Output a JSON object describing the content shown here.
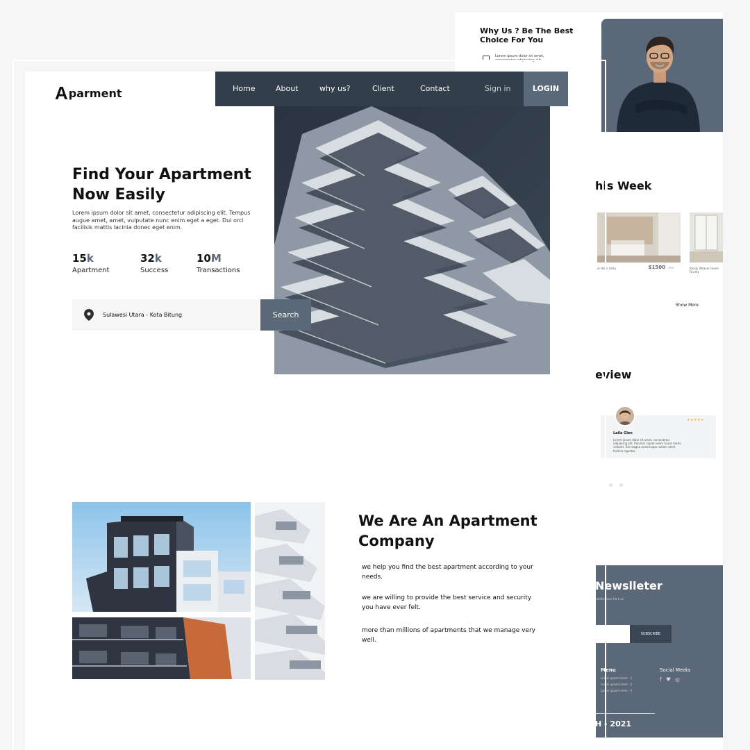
{
  "back_page": {
    "why_us": {
      "title": "Why Us ? Be The Best Choice For You",
      "item_text": "Lorem ipsum dolor sit amet, consectetur adipiscing elit."
    },
    "this_week": {
      "title": "his Week",
      "cards": [
        {
          "caption": "el Hotel Unity",
          "price": "$1500",
          "per": "/mo"
        },
        {
          "caption": "Ready Weaver Home Facility",
          "price": "",
          "per": ""
        }
      ],
      "show_more": "Show More"
    },
    "review": {
      "title": "eview",
      "name": "Laila Glen",
      "text": "Lorem ipsum dolor sit amet, consectetur adipiscing elit. Pulvinar sapien enim turpis morbi sodales. Est magna scelerisque nullam amet facilisis egestas.",
      "stars": "★★★★★"
    },
    "footer": {
      "newsletter_title": "Newslleter",
      "newsletter_sub": "notifications from us",
      "subscribe_label": "SUBSCRIBE",
      "menu_title": "Menu",
      "menu_items": [
        "Lorem ipsum lorem - 1",
        "Lorem ipsum lorem - 2",
        "Lorem ipsum lorem - 3"
      ],
      "social_title": "Social Media",
      "copyright": "H - 2021"
    }
  },
  "front_page": {
    "logo": {
      "mark": "A",
      "text": "parment"
    },
    "nav": {
      "items": [
        "Home",
        "About",
        "why us?",
        "Client",
        "Contact"
      ],
      "signin": "Sign in",
      "login": "LOGIN"
    },
    "hero": {
      "title": "Find Your Apartment Now Easily",
      "description": "Lorem ipsum dolor sit amet, consectetur adipiscing elit. Tempus augue amet, amet, vulputate nunc enim eget a eget. Dui orci facilisis mattis lacinia donec eget enim.",
      "stats": [
        {
          "number": "15",
          "suffix": "k",
          "label": "Apartment"
        },
        {
          "number": "32",
          "suffix": "k",
          "label": "Success"
        },
        {
          "number": "10",
          "suffix": "M",
          "label": "Transactions"
        }
      ],
      "search": {
        "location": "Sulawesi Utara - Kota Bitung",
        "button": "Search"
      }
    },
    "about": {
      "title": "We Are An Apartment Company",
      "paragraphs": [
        "we help you find the best apartment according to your needs.",
        "we are willing to provide the best service and security you have ever felt.",
        "more than millions of apartments that we manage very well."
      ]
    }
  },
  "colors": {
    "accent": "#5b6878",
    "nav_dark": "#333e4b",
    "page_bg": "#f6f6f7"
  }
}
